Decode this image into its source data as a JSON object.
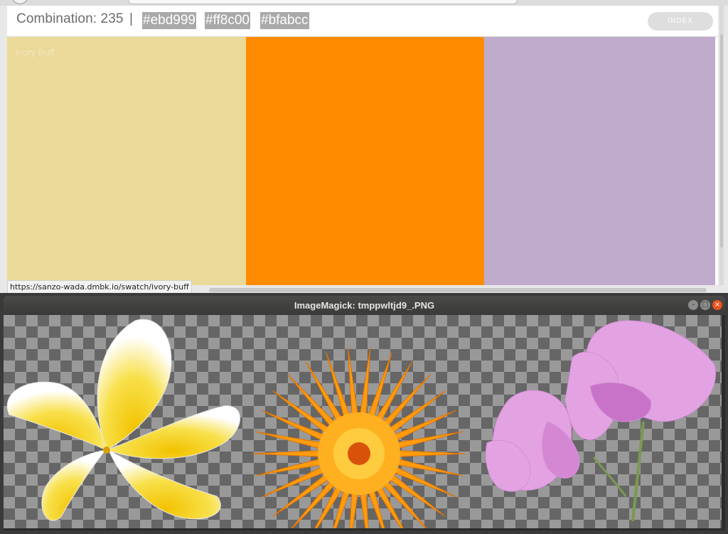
{
  "browser": {
    "combination_label": "Combination: 235",
    "separator": "|",
    "hex_codes": [
      "#ebd999",
      "#ff8c00",
      "#bfabcc"
    ],
    "index_button": "INDEX",
    "swatches": [
      {
        "color": "#ebd999",
        "label": "Ivory Buff"
      },
      {
        "color": "#ff8c00",
        "label": ""
      },
      {
        "color": "#bfabcc",
        "label": ""
      }
    ],
    "status_url": "https://sanzo-wada.dmbk.io/swatch/ivory-buff"
  },
  "image_window": {
    "title": "ImageMagick: tmppwltjd9_.PNG",
    "controls": [
      "minimize",
      "maximize",
      "close"
    ],
    "images": [
      {
        "subject": "white-yellow-plumeria-flower",
        "main_color": "#ffffff",
        "accent_color": "#f6d000"
      },
      {
        "subject": "orange-calendula-flower",
        "main_color": "#ff9c10",
        "accent_color": "#d9520a"
      },
      {
        "subject": "pink-sweet-pea-flowers",
        "main_color": "#e3a3e3",
        "accent_color": "#c873c8"
      }
    ]
  }
}
